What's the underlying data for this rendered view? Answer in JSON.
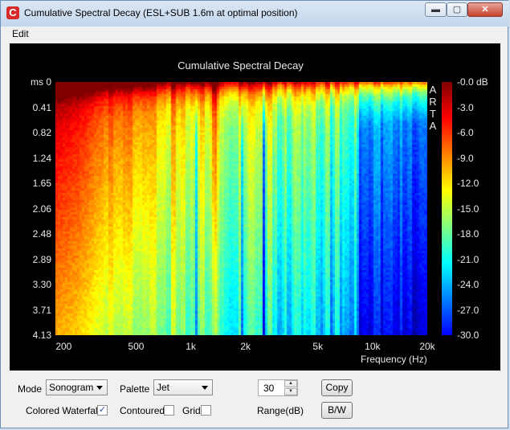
{
  "window": {
    "title": "Cumulative Spectral Decay  (ESL+SUB 1.6m at optimal position)",
    "app_icon": "C",
    "minimize_glyph": "▬",
    "maximize_glyph": "▢",
    "close_glyph": "✕"
  },
  "menu": {
    "items": [
      "Edit"
    ]
  },
  "chart_data": {
    "type": "heatmap",
    "title": "Cumulative Spectral Decay",
    "ylabel": "ms",
    "xlabel": "Frequency (Hz)",
    "y_ticks": [
      "0",
      "0.41",
      "0.82",
      "1.24",
      "1.65",
      "2.06",
      "2.48",
      "2.89",
      "3.30",
      "3.71",
      "4.13"
    ],
    "x_ticks": [
      "200",
      "500",
      "1k",
      "2k",
      "5k",
      "10k",
      "20k"
    ],
    "x_tick_values": [
      200,
      500,
      1000,
      2000,
      5000,
      10000,
      20000
    ],
    "xlim": [
      180,
      20000
    ],
    "ylim": [
      0,
      4.13
    ],
    "x_scale": "log",
    "colorbar_ticks": [
      "-0.0 dB",
      "-3.0",
      "-6.0",
      "-9.0",
      "-12.0",
      "-15.0",
      "-18.0",
      "-21.0",
      "-24.0",
      "-27.0",
      "-30.0"
    ],
    "colorbar_range": [
      -30,
      0
    ],
    "watermark": "ARTA",
    "palette": "jet"
  },
  "controls": {
    "mode_label": "Mode",
    "mode_value": "Sonogram",
    "palette_label": "Palette",
    "palette_value": "Jet",
    "range_value": "30",
    "range_label": "Range(dB)",
    "copy_label": "Copy",
    "bw_label": "B/W",
    "colored_waterfall_label": "Colored Waterfall",
    "colored_waterfall_checked": true,
    "contoured_label": "Contoured",
    "contoured_checked": false,
    "grid_label": "Grid",
    "grid_checked": false,
    "spin_up": "▲",
    "spin_down": "▼",
    "check_mark": "✓"
  }
}
